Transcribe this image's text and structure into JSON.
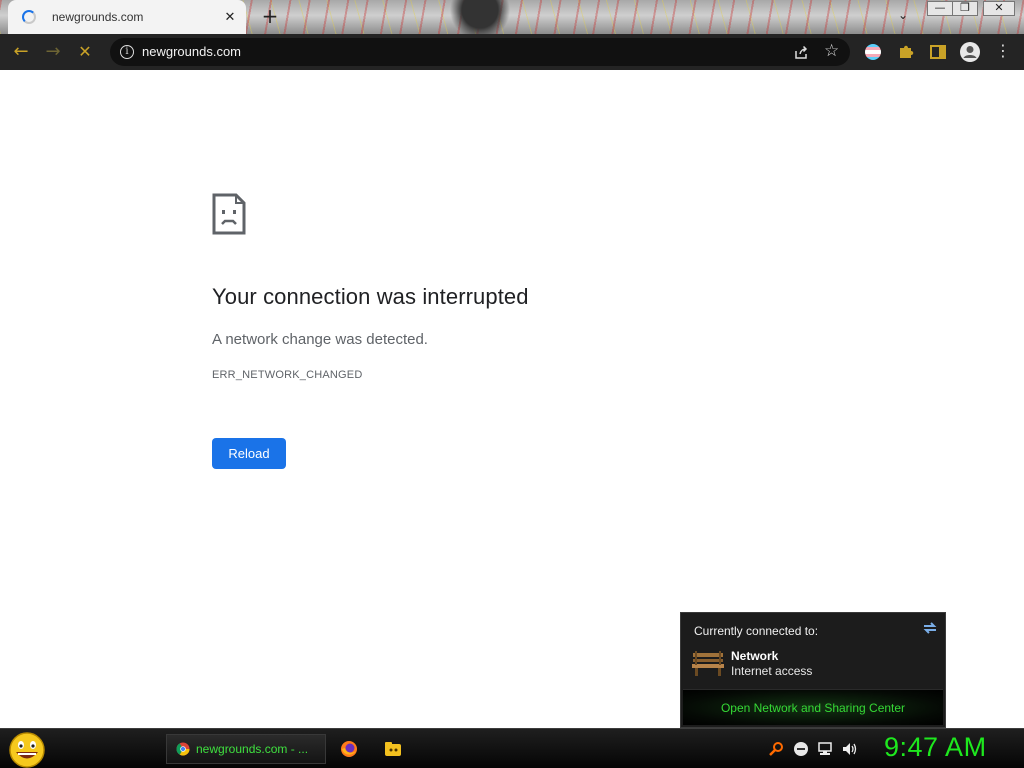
{
  "browser": {
    "tab": {
      "title": "newgrounds.com",
      "close_glyph": "✕"
    },
    "new_tab_glyph": "+",
    "tab_search_glyph": "⌄",
    "window_controls": {
      "minimize": "—",
      "maximize": "❐",
      "close": "✕"
    },
    "nav": {
      "back": "←",
      "forward": "→",
      "stop": "✕"
    },
    "omnibox": {
      "info_glyph": "i",
      "url": "newgrounds.com",
      "share_icon": "share-icon",
      "bookmark_glyph": "☆"
    },
    "toolbar_icons": [
      "profile-flag-icon",
      "extensions-puzzle-icon",
      "side-panel-icon",
      "account-avatar-icon",
      "menu-kebab-icon"
    ],
    "menu_glyph": "⋮"
  },
  "error_page": {
    "title": "Your connection was interrupted",
    "message": "A network change was detected.",
    "code": "ERR_NETWORK_CHANGED",
    "reload_label": "Reload"
  },
  "network_flyout": {
    "heading": "Currently connected to:",
    "network_name": "Network",
    "network_status": "Internet access",
    "link": "Open Network and Sharing Center"
  },
  "taskbar": {
    "window_button": "newgrounds.com - ...",
    "clock": "9:47 AM"
  },
  "colors": {
    "accent": "#1a73e8",
    "toolbar": "#242424",
    "taskbar_text": "#3fe03f",
    "clock": "#1ee81e",
    "nav_active": "#c9a227"
  }
}
